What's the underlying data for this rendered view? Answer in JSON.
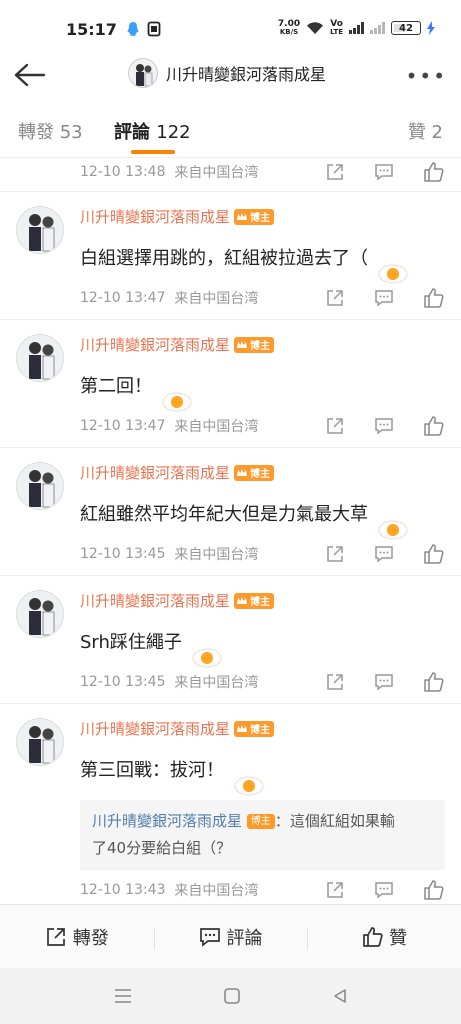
{
  "status_bar": {
    "time": "15:17",
    "net_speed_top": "7.00",
    "net_speed_bottom": "KB/S",
    "vo_top": "Vo",
    "vo_bottom": "LTE",
    "battery": "42"
  },
  "header": {
    "title": "川升晴變銀河落雨成星",
    "more": "•••"
  },
  "tabs": [
    {
      "label": "轉發",
      "count": "53"
    },
    {
      "label": "評論",
      "count": "122"
    },
    {
      "label": "贊",
      "count": "2"
    }
  ],
  "badge_label": "博主",
  "top_meta": {
    "time": "12-10 13:48",
    "location": "来自中国台湾"
  },
  "comments": [
    {
      "name": "川升晴變銀河落雨成星",
      "text": "白組選擇用跳的，紅組被拉過去了（",
      "time": "12-10 13:47",
      "location": "来自中国台湾"
    },
    {
      "name": "川升晴變銀河落雨成星",
      "text": "第二回！",
      "time": "12-10 13:47",
      "location": "来自中国台湾"
    },
    {
      "name": "川升晴變銀河落雨成星",
      "text": "紅組雖然平均年紀大但是力氣最大草",
      "time": "12-10 13:45",
      "location": "来自中国台湾"
    },
    {
      "name": "川升晴變銀河落雨成星",
      "text": "Srh踩住繩子",
      "time": "12-10 13:45",
      "location": "来自中国台湾"
    },
    {
      "name": "川升晴變銀河落雨成星",
      "text": "第三回戰：拔河！",
      "time": "12-10 13:43",
      "location": "来自中国台湾",
      "quote": {
        "name": "川升晴變銀河落雨成星",
        "sep": "：",
        "line1": "這個紅組如果輸",
        "line2": "了40分要給白組（？"
      }
    }
  ],
  "bottom_bar": {
    "repost": "轉發",
    "comment": "評論",
    "like": "贊"
  },
  "colors": {
    "accent": "#ff8200",
    "name": "#eb7350",
    "badge": "#ff9a2a",
    "quote_name": "#507daf"
  }
}
